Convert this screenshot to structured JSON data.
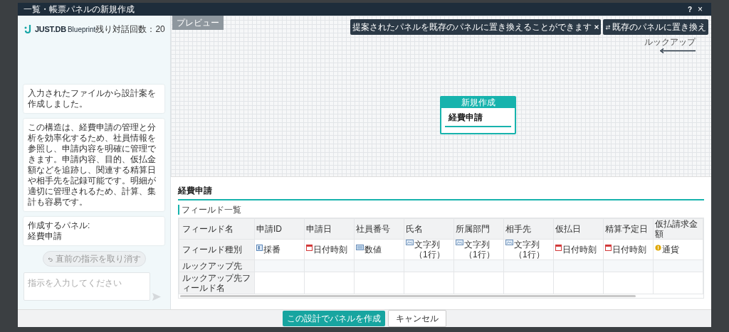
{
  "window": {
    "title": "一覧・帳票パネルの新規作成",
    "help": "?",
    "close": "×"
  },
  "sidebar": {
    "logo_main": "JUST.DB",
    "logo_sub": "Blueprint",
    "remaining": "残り対話回数：20",
    "messages": [
      "入力されたファイルから設計案を作成しました。",
      "この構造は、経費申請の管理と分析を効率化するため、社員情報を参照し、申請内容を明確に管理できます。申請内容、目的、仮払金額などを追跡し、関連する精算日や相手先を記録可能です。明細が適切に管理されるため、計算、集計も容易です。",
      "作成するパネル:\n経費申請"
    ],
    "undo_button": "直前の指示を取り消す",
    "input": {
      "placeholder": "指示を入力してください"
    }
  },
  "preview": {
    "tab": "プレビュー",
    "hint": "提案されたパネルを既存のパネルに置き換えることができます",
    "replace_button": "既存のパネルに置き換え",
    "lookup_label": "ルックアップ",
    "node": {
      "badge": "新規作成",
      "name": "経費申請"
    }
  },
  "details": {
    "title": "経費申請",
    "section": "フィールド一覧",
    "row_headers": [
      "フィールド名",
      "フィールド種別",
      "ルックアップ先",
      "ルックアップ先フィールド名"
    ],
    "fields": [
      {
        "name": "申請ID",
        "type": "採番",
        "kind": "autonumber"
      },
      {
        "name": "申請日",
        "type": "日付時刻",
        "kind": "datetime"
      },
      {
        "name": "社員番号",
        "type": "数値",
        "kind": "number"
      },
      {
        "name": "氏名",
        "type": "文字列（1行）",
        "kind": "text"
      },
      {
        "name": "所属部門",
        "type": "文字列（1行）",
        "kind": "text"
      },
      {
        "name": "相手先",
        "type": "文字列（1行）",
        "kind": "text"
      },
      {
        "name": "仮払日",
        "type": "日付時刻",
        "kind": "datetime"
      },
      {
        "name": "精算予定日",
        "type": "日付時刻",
        "kind": "datetime"
      },
      {
        "name": "仮払請求金額",
        "type": "通貨",
        "kind": "currency"
      }
    ]
  },
  "footer": {
    "create_button": "この設計でパネルを作成",
    "cancel_button": "キャンセル"
  }
}
